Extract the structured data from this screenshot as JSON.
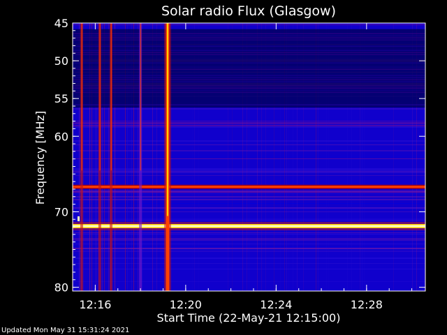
{
  "chart_data": {
    "type": "heatmap",
    "title": "Solar radio Flux (Glasgow)",
    "xlabel": "Start Time (22-May-21 12:15:00)",
    "ylabel": "Frequency [MHz]",
    "x_unit": "minutes after 12:15:00",
    "xlim": [
      0,
      15.6
    ],
    "ylim": [
      45,
      80.5
    ],
    "x_ticks": [
      {
        "value": 1,
        "label": "12:16"
      },
      {
        "value": 5,
        "label": "12:20"
      },
      {
        "value": 9,
        "label": "12:24"
      },
      {
        "value": 13,
        "label": "12:28"
      }
    ],
    "y_ticks": [
      {
        "value": 45,
        "label": "45"
      },
      {
        "value": 50,
        "label": "50"
      },
      {
        "value": 55,
        "label": "55"
      },
      {
        "value": 60,
        "label": "60"
      },
      {
        "value": 70,
        "label": "70"
      },
      {
        "value": 80,
        "label": "80"
      }
    ],
    "colormap": [
      "#000040",
      "#0000c8",
      "#3a10d8",
      "#7a1ac8",
      "#c81010",
      "#ff4000",
      "#ffd000",
      "#ffffc0"
    ],
    "horizontal_bands": [
      {
        "freq_mhz": 66.7,
        "level": 0.66
      },
      {
        "freq_mhz": 71.9,
        "level": 0.98
      }
    ],
    "vertical_bursts": [
      {
        "time_min": 0.4,
        "level": 0.55
      },
      {
        "time_min": 1.2,
        "level": 0.6
      },
      {
        "time_min": 1.7,
        "level": 0.55
      },
      {
        "time_min": 3.0,
        "level": 0.4
      },
      {
        "time_min": 4.2,
        "level": 0.95
      }
    ],
    "low_intensity_band_mhz": [
      45.8,
      56.2
    ]
  },
  "footer": {
    "updated": "Updated Mon May 31 15:31:24 2021"
  }
}
